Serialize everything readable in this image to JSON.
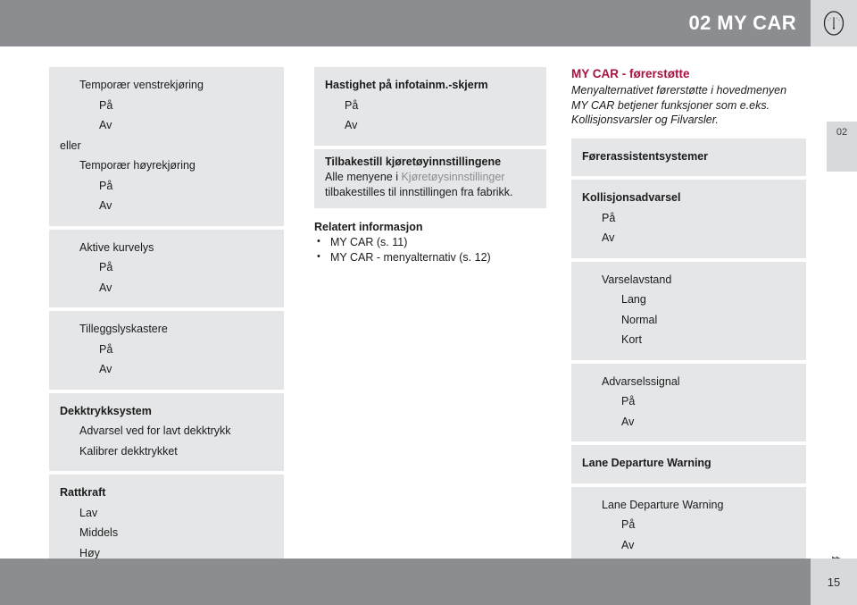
{
  "header": {
    "title": "02 MY CAR",
    "icon": "gauge-icon"
  },
  "edge_tab": {
    "label": "02"
  },
  "colors": {
    "header_band": "#8b8d91",
    "box_bg": "#e4e6e8",
    "accent_red": "#a8123c",
    "reference_gray": "#8a8d92",
    "tab_bg": "#d8d9db"
  },
  "left_column": {
    "boxes": [
      {
        "rows": [
          {
            "text": "Temporær venstrekjøring",
            "level": 1,
            "bold": false
          },
          {
            "text": "På",
            "level": 2,
            "bold": false
          },
          {
            "text": "Av",
            "level": 2,
            "bold": false
          }
        ],
        "outside_note": "eller",
        "rows_after": [
          {
            "text": "Temporær høyrekjøring",
            "level": 1,
            "bold": false
          },
          {
            "text": "På",
            "level": 2,
            "bold": false
          },
          {
            "text": "Av",
            "level": 2,
            "bold": false
          }
        ]
      },
      {
        "rows": [
          {
            "text": "Aktive kurvelys",
            "level": 1,
            "bold": false
          },
          {
            "text": "På",
            "level": 2,
            "bold": false
          },
          {
            "text": "Av",
            "level": 2,
            "bold": false
          }
        ]
      },
      {
        "rows": [
          {
            "text": "Tilleggslyskastere",
            "level": 1,
            "bold": false
          },
          {
            "text": "På",
            "level": 2,
            "bold": false
          },
          {
            "text": "Av",
            "level": 2,
            "bold": false
          }
        ]
      },
      {
        "rows": [
          {
            "text": "Dekktrykksystem",
            "level": 0,
            "bold": true
          },
          {
            "text": "Advarsel ved for lavt dekktrykk",
            "level": 1,
            "bold": false
          },
          {
            "text": "Kalibrer dekktrykket",
            "level": 1,
            "bold": false
          }
        ]
      },
      {
        "rows": [
          {
            "text": "Rattkraft",
            "level": 0,
            "bold": true
          },
          {
            "text": "Lav",
            "level": 1,
            "bold": false
          },
          {
            "text": "Middels",
            "level": 1,
            "bold": false
          },
          {
            "text": "Høy",
            "level": 1,
            "bold": false
          }
        ]
      }
    ]
  },
  "middle_column": {
    "boxes": [
      {
        "rows": [
          {
            "text": "Hastighet på infotainm.-skjerm",
            "level": 0,
            "bold": true
          },
          {
            "text": "På",
            "level": 1,
            "bold": false
          },
          {
            "text": "Av",
            "level": 1,
            "bold": false
          }
        ]
      }
    ],
    "reset_box": {
      "heading": "Tilbakestill kjøretøyinnstillingene",
      "body_pre": "Alle menyene i ",
      "body_ref": "Kjøretøysinnstillinger",
      "body_post": " tilbakestilles til innstillingen fra fabrikk."
    },
    "related": {
      "heading": "Relatert informasjon",
      "items": [
        "MY CAR (s. 11)",
        "MY CAR - menyalternativ (s. 12)"
      ]
    }
  },
  "right_column": {
    "title": "MY CAR - førerstøtte",
    "intro": "Menyalternativet førerstøtte i hovedmenyen MY CAR betjener funksjoner som e.eks. Kollisjonsvarsler og Filvarsler.",
    "boxes": [
      {
        "rows": [
          {
            "text": "Førerassistentsystemer",
            "level": 0,
            "bold": true
          }
        ]
      },
      {
        "rows": [
          {
            "text": "Kollisjonsadvarsel",
            "level": 0,
            "bold": true
          },
          {
            "text": "På",
            "level": 1,
            "bold": false
          },
          {
            "text": "Av",
            "level": 1,
            "bold": false
          }
        ]
      },
      {
        "rows": [
          {
            "text": "Varselavstand",
            "level": 1,
            "bold": false
          },
          {
            "text": "Lang",
            "level": 2,
            "bold": false
          },
          {
            "text": "Normal",
            "level": 2,
            "bold": false
          },
          {
            "text": "Kort",
            "level": 2,
            "bold": false
          }
        ]
      },
      {
        "rows": [
          {
            "text": "Advarselssignal",
            "level": 1,
            "bold": false
          },
          {
            "text": "På",
            "level": 2,
            "bold": false
          },
          {
            "text": "Av",
            "level": 2,
            "bold": false
          }
        ]
      },
      {
        "rows": [
          {
            "text": "Lane Departure Warning",
            "level": 0,
            "bold": true
          }
        ]
      },
      {
        "rows": [
          {
            "text": "Lane Departure Warning",
            "level": 1,
            "bold": false
          },
          {
            "text": "På",
            "level": 2,
            "bold": false
          },
          {
            "text": "Av",
            "level": 2,
            "bold": false
          }
        ]
      }
    ]
  },
  "footer": {
    "arrows": "▸▸",
    "page_number": "15"
  }
}
